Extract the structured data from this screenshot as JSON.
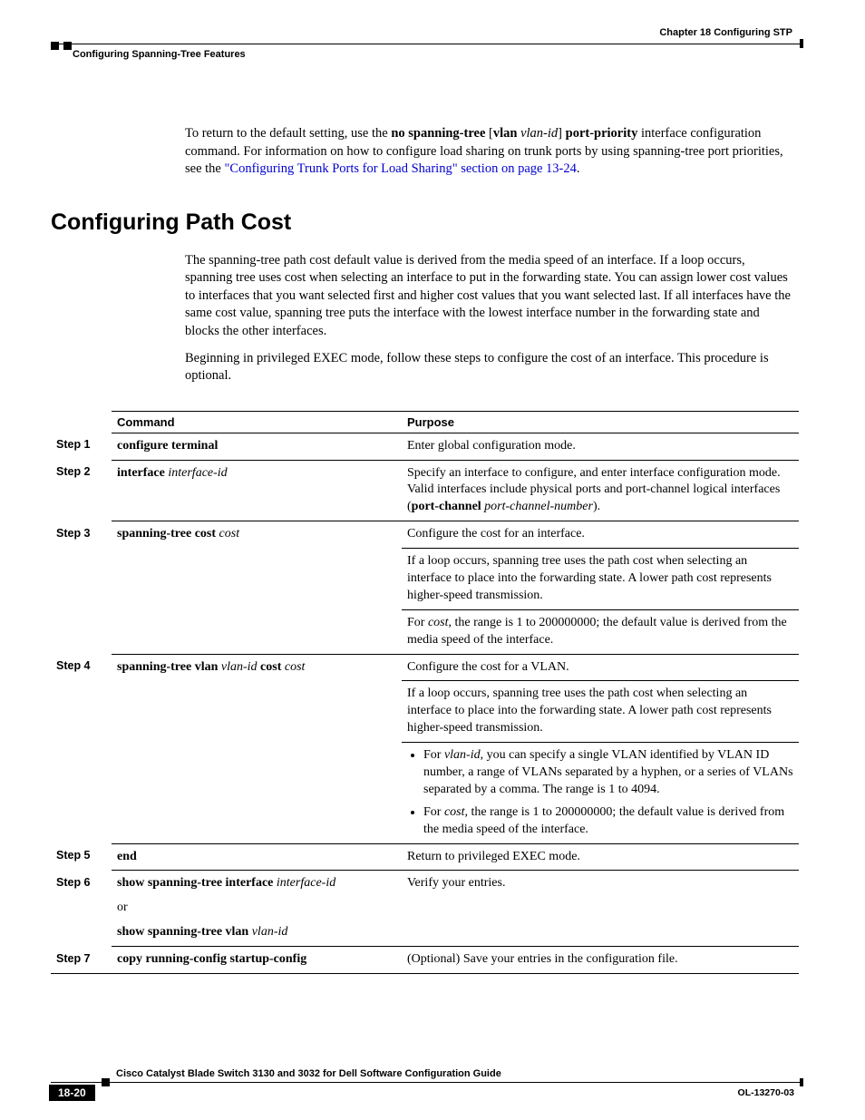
{
  "header": {
    "chapter": "Chapter 18      Configuring STP",
    "breadcrumb": "Configuring Spanning-Tree Features"
  },
  "intro": {
    "p1_pre": "To return to the default setting, use the ",
    "p1_cmd1": "no spanning-tree",
    "p1_mid1": " [",
    "p1_cmd2": "vlan",
    "p1_ital1": " vlan-id",
    "p1_mid2": "] ",
    "p1_cmd3": "port-priority",
    "p1_post": " interface configuration command. For information on how to configure load sharing on trunk ports by using spanning-tree port priorities, see the ",
    "p1_link": "\"Configuring Trunk Ports for Load Sharing\" section on page 13-24",
    "p1_end": "."
  },
  "heading": "Configuring Path Cost",
  "para": {
    "p1": "The spanning-tree path cost default value is derived from the media speed of an interface. If a loop occurs, spanning tree uses cost when selecting an interface to put in the forwarding state. You can assign lower cost values to interfaces that you want selected first and higher cost values that you want selected last. If all interfaces have the same cost value, spanning tree puts the interface with the lowest interface number in the forwarding state and blocks the other interfaces.",
    "p2": "Beginning in privileged EXEC mode, follow these steps to configure the cost of an interface. This procedure is optional."
  },
  "table": {
    "head_cmd": "Command",
    "head_purpose": "Purpose",
    "steps": {
      "s1": {
        "label": "Step 1",
        "cmd": "configure terminal",
        "purpose": "Enter global configuration mode."
      },
      "s2": {
        "label": "Step 2",
        "cmd_b": "interface ",
        "cmd_i": "interface-id",
        "p_pre": "Specify an interface to configure, and enter interface configuration mode. Valid interfaces include physical ports and port-channel logical interfaces (",
        "p_b": "port-channel ",
        "p_i": "port-channel-number",
        "p_post": ")."
      },
      "s3": {
        "label": "Step 3",
        "cmd_b": "spanning-tree cost ",
        "cmd_i": "cost",
        "p1": "Configure the cost for an interface.",
        "p2": "If a loop occurs, spanning tree uses the path cost when selecting an interface to place into the forwarding state. A lower path cost represents higher-speed transmission.",
        "p3a": "For ",
        "p3i": "cost",
        "p3b": ", the range is 1 to 200000000; the default value is derived from the media speed of the interface."
      },
      "s4": {
        "label": "Step 4",
        "cmd_b1": "spanning-tree vlan ",
        "cmd_i1": "vlan-id",
        "cmd_b2": " cost ",
        "cmd_i2": "cost",
        "p1": "Configure the cost for a VLAN.",
        "p2": "If a loop occurs, spanning tree uses the path cost when selecting an interface to place into the forwarding state. A lower path cost represents higher-speed transmission.",
        "li1a": "For ",
        "li1i": "vlan-id",
        "li1b": ", you can specify a single VLAN identified by VLAN ID number, a range of VLANs separated by a hyphen, or a series of VLANs separated by a comma. The range is 1 to 4094.",
        "li2a": "For ",
        "li2i": "cost",
        "li2b": ", the range is 1 to 200000000; the default value is derived from the media speed of the interface."
      },
      "s5": {
        "label": "Step 5",
        "cmd": "end",
        "purpose": "Return to privileged EXEC mode."
      },
      "s6": {
        "label": "Step 6",
        "cmd1b": "show spanning-tree interface ",
        "cmd1i": "interface-id",
        "or": "or",
        "cmd2b": "show spanning-tree vlan ",
        "cmd2i": "vlan-id",
        "purpose": "Verify your entries."
      },
      "s7": {
        "label": "Step 7",
        "cmd": "copy running-config startup-config",
        "purpose": "(Optional) Save your entries in the configuration file."
      }
    }
  },
  "footer": {
    "book": "Cisco Catalyst Blade Switch 3130 and 3032 for Dell Software Configuration Guide",
    "page": "18-20",
    "docid": "OL-13270-03"
  }
}
